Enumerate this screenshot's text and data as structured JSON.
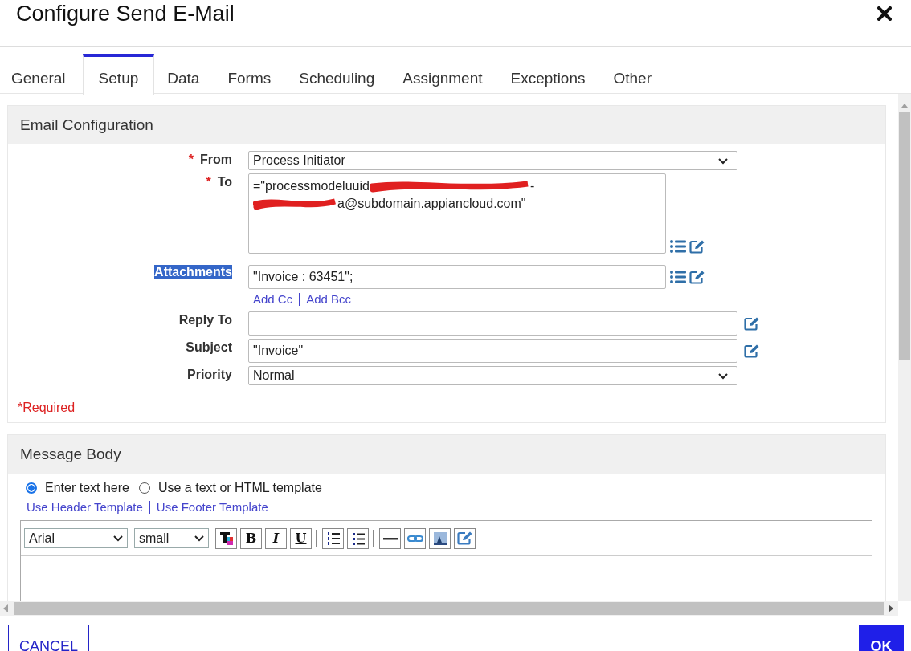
{
  "window": {
    "title": "Configure Send E-Mail"
  },
  "tabs": [
    {
      "label": "General",
      "selected": false
    },
    {
      "label": "Setup",
      "selected": true
    },
    {
      "label": "Data",
      "selected": false
    },
    {
      "label": "Forms",
      "selected": false
    },
    {
      "label": "Scheduling",
      "selected": false
    },
    {
      "label": "Assignment",
      "selected": false
    },
    {
      "label": "Exceptions",
      "selected": false
    },
    {
      "label": "Other",
      "selected": false
    }
  ],
  "email_configuration": {
    "title": "Email Configuration",
    "fields": [
      {
        "kind": "select",
        "label": "From",
        "required": true,
        "highlighted": false,
        "value": "Process Initiator"
      },
      {
        "kind": "textarea",
        "label": "To",
        "required": true,
        "highlighted": false,
        "parts": [
          {
            "kind": "text",
            "text": "=\"processmodeluuid"
          },
          {
            "kind": "redaction"
          },
          {
            "kind": "text",
            "text": "-"
          },
          {
            "kind": "break"
          },
          {
            "kind": "redaction"
          },
          {
            "kind": "text",
            "text": "a@subdomain.appiancloud.com\""
          }
        ]
      },
      {
        "kind": "short",
        "label": "Attachments",
        "required": false,
        "highlighted": true,
        "value": "\"Invoice : 63451\";"
      },
      {
        "kind": "links",
        "links": [
          "Add Cc",
          "Add Bcc"
        ]
      },
      {
        "kind": "wide",
        "label": "Reply To",
        "required": false,
        "highlighted": false
      },
      {
        "kind": "wide",
        "label": "Subject",
        "required": false,
        "highlighted": false,
        "value": "\"Invoice\""
      },
      {
        "kind": "select",
        "label": "Priority",
        "required": false,
        "highlighted": false,
        "value": "Normal"
      }
    ],
    "required_mark": "*",
    "required_note": "*Required"
  },
  "message_body": {
    "title": "Message Body",
    "options": [
      {
        "label": "Enter text here",
        "selected": true
      },
      {
        "label": "Use a text or HTML template",
        "selected": false
      }
    ],
    "links": [
      "Use Header Template",
      "Use Footer Template"
    ],
    "editor": {
      "font": "Arial",
      "size": "small",
      "format_buttons": [
        "B",
        "I",
        "U"
      ]
    }
  },
  "buttons": {
    "cancel": "CANCEL",
    "ok": "OK"
  }
}
